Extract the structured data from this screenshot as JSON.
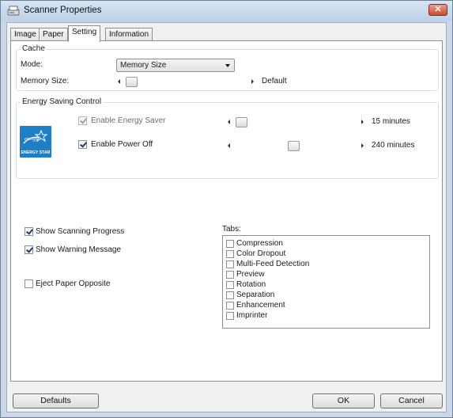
{
  "window": {
    "title": "Scanner Properties",
    "close_glyph": "✕"
  },
  "tabs": [
    {
      "label": "Image"
    },
    {
      "label": "Paper"
    },
    {
      "label": "Setting"
    },
    {
      "label": "Information"
    }
  ],
  "cache": {
    "title": "Cache",
    "mode_label": "Mode:",
    "mode_value": "Memory Size",
    "memory_size_label": "Memory Size:",
    "memory_size_value": "Default"
  },
  "energy": {
    "title": "Energy Saving Control",
    "logo_text": "ENERGY STAR",
    "enable_saver_label": "Enable Energy Saver",
    "enable_saver_checked": true,
    "saver_value": "15 minutes",
    "enable_power_off_label": "Enable Power Off",
    "enable_power_off_checked": true,
    "power_off_value": "240 minutes"
  },
  "options": {
    "show_progress_label": "Show Scanning Progress",
    "show_progress_checked": true,
    "show_warning_label": "Show Warning Message",
    "show_warning_checked": true,
    "eject_opposite_label": "Eject Paper Opposite",
    "eject_opposite_checked": false
  },
  "tabs_list": {
    "label": "Tabs:",
    "items": [
      {
        "label": "Compression"
      },
      {
        "label": "Color Dropout"
      },
      {
        "label": "Multi-Feed Detection"
      },
      {
        "label": "Preview"
      },
      {
        "label": "Rotation"
      },
      {
        "label": "Separation"
      },
      {
        "label": "Enhancement"
      },
      {
        "label": "Imprinter"
      }
    ]
  },
  "buttons": {
    "defaults": "Defaults",
    "ok": "OK",
    "cancel": "Cancel"
  },
  "colors": {
    "accent": "#1f7fc4",
    "close": "#c64a2f"
  }
}
